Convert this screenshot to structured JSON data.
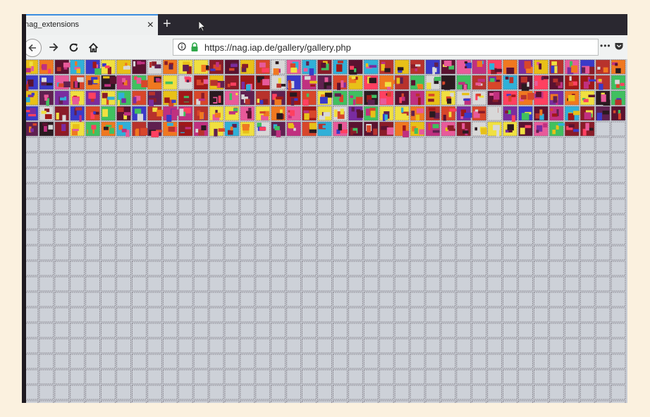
{
  "browser": {
    "tab_title": "nag_extensions",
    "new_tab_symbol": "+",
    "close_symbol": "×",
    "url": "https://nag.iap.de/gallery/gallery.php",
    "menu_symbol": "•••"
  },
  "icons": [
    "back-arrow-icon",
    "forward-arrow-icon",
    "reload-icon",
    "home-icon",
    "info-icon",
    "lock-icon",
    "page-actions-menu-icon",
    "pocket-icon",
    "mouse-cursor-icon"
  ],
  "gallery": {
    "filled_thumbnail_rows": 5,
    "thumbnails_per_row": 39,
    "colors": {
      "empty_cell": "#cdd1d8",
      "cell_border": "#6e6870",
      "lock_green": "#2fa84a",
      "tab_accent": "#3b8de0"
    }
  }
}
